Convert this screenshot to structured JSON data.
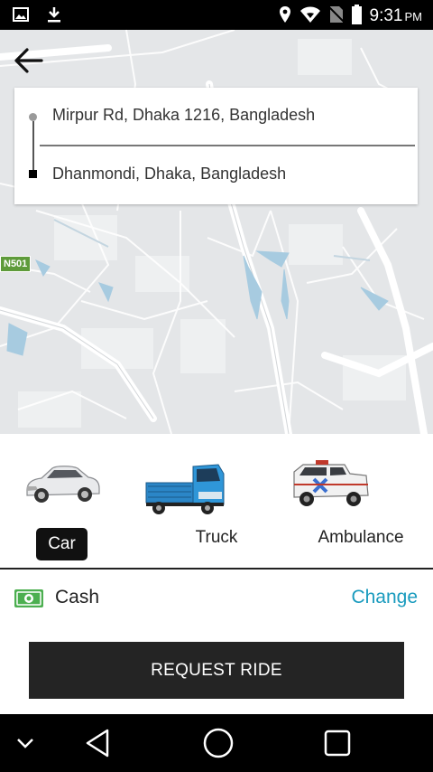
{
  "status_bar": {
    "time": "9:31",
    "ampm": "PM",
    "icons": [
      "image-icon",
      "download-icon",
      "location-icon",
      "wifi-icon",
      "no-sim-icon",
      "battery-icon"
    ]
  },
  "map": {
    "road_label": "N501"
  },
  "route": {
    "pickup": "Mirpur Rd, Dhaka 1216, Bangladesh",
    "dropoff": "Dhanmondi, Dhaka, Bangladesh"
  },
  "vehicles": [
    {
      "label": "Car",
      "icon": "car-icon",
      "selected": true
    },
    {
      "label": "Truck",
      "icon": "truck-icon",
      "selected": false
    },
    {
      "label": "Ambulance",
      "icon": "ambulance-icon",
      "selected": false
    }
  ],
  "payment": {
    "method": "Cash",
    "change_label": "Change"
  },
  "request_button": "REQUEST RIDE",
  "colors": {
    "accent": "#1a9bbe",
    "button": "#242424",
    "cash_green": "#4caf50",
    "map_bg": "#e4e6e8"
  }
}
